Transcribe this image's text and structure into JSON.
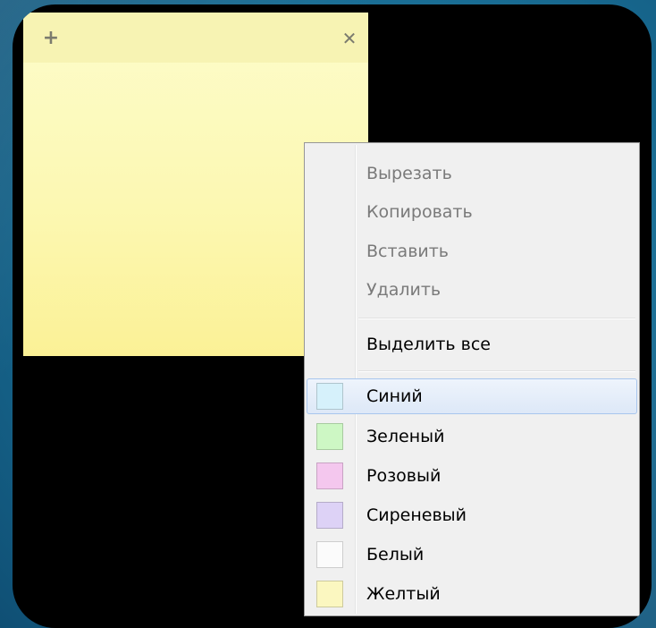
{
  "note": {
    "add_icon": "plus-icon",
    "close_icon": "close-icon",
    "color": "#fcf8b3"
  },
  "menu": {
    "edit_items": [
      {
        "label": "Вырезать",
        "enabled": false
      },
      {
        "label": "Копировать",
        "enabled": false
      },
      {
        "label": "Вставить",
        "enabled": false
      },
      {
        "label": "Удалить",
        "enabled": false
      }
    ],
    "select_all": {
      "label": "Выделить все",
      "enabled": true
    },
    "colors": [
      {
        "label": "Синий",
        "swatch": "#d6f1fb",
        "selected": true
      },
      {
        "label": "Зеленый",
        "swatch": "#cdf7c4",
        "selected": false
      },
      {
        "label": "Розовый",
        "swatch": "#f4c7ee",
        "selected": false
      },
      {
        "label": "Сиреневый",
        "swatch": "#ddd2f6",
        "selected": false
      },
      {
        "label": "Белый",
        "swatch": "#fbfbfb",
        "selected": false
      },
      {
        "label": "Желтый",
        "swatch": "#fbf7c0",
        "selected": false
      }
    ]
  }
}
